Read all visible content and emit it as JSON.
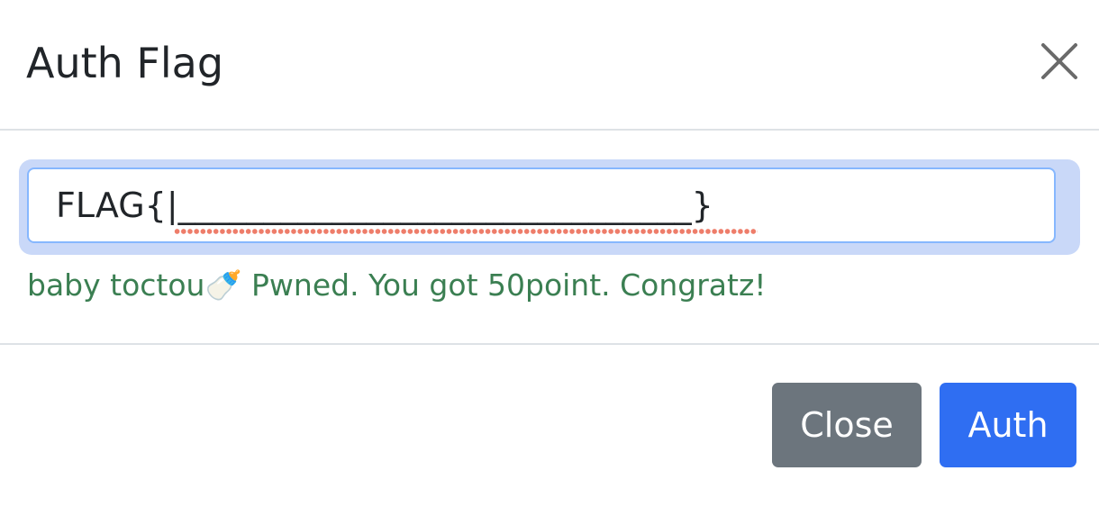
{
  "modal": {
    "title": "Auth Flag",
    "close_icon": "close-icon"
  },
  "form": {
    "flag_value": "FLAG{|______________________________}",
    "feedback_text": "baby toctou🍼 Pwned. You got 50point. Congratz!",
    "feedback_color": "#3b7f52",
    "focus_ring_color": "#c9d8f8",
    "spellcheck_color": "#ee7d6a"
  },
  "footer": {
    "close_label": "Close",
    "auth_label": "Auth",
    "close_color": "#6c757d",
    "auth_color": "#2f6ef2"
  }
}
